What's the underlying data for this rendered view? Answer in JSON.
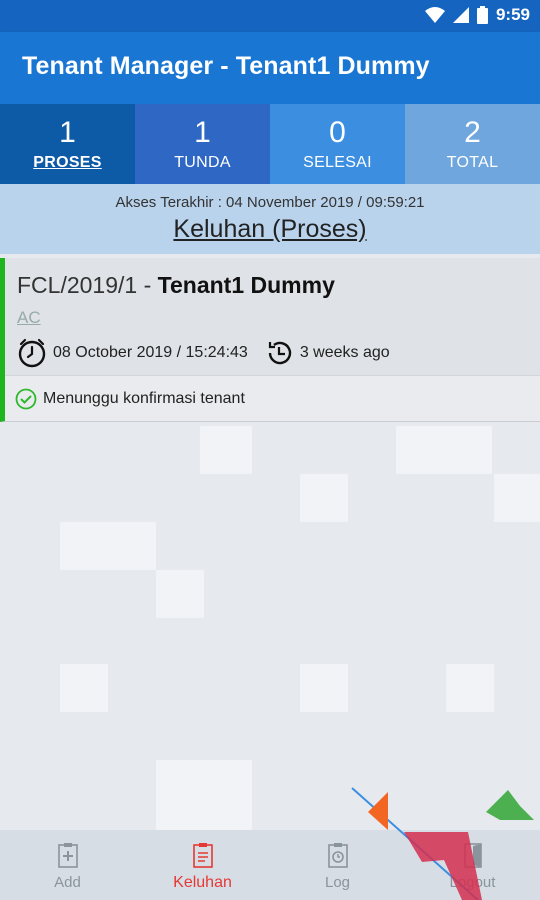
{
  "status_bar": {
    "time": "9:59"
  },
  "app_bar": {
    "title": "Tenant Manager - Tenant1 Dummy"
  },
  "stats": [
    {
      "count": "1",
      "label": "PROSES"
    },
    {
      "count": "1",
      "label": "TUNDA"
    },
    {
      "count": "0",
      "label": "SELESAI"
    },
    {
      "count": "2",
      "label": "TOTAL"
    }
  ],
  "info": {
    "last_access": "Akses Terakhir : 04 November 2019 / 09:59:21",
    "heading": "Keluhan (Proses)"
  },
  "complaint": {
    "code": "FCL/2019/1",
    "separator": " - ",
    "tenant": "Tenant1 Dummy",
    "category": "AC",
    "datetime": "08 October 2019 / 15:24:43",
    "relative": "3 weeks ago",
    "status": "Menunggu konfirmasi tenant",
    "accent_color": "#1eb51e"
  },
  "bottom_nav": [
    {
      "label": "Add",
      "icon": "add-note-icon"
    },
    {
      "label": "Keluhan",
      "icon": "clipboard-icon"
    },
    {
      "label": "Log",
      "icon": "log-clock-icon"
    },
    {
      "label": "Logout",
      "icon": "logout-door-icon"
    }
  ],
  "colors": {
    "primary": "#1976d2",
    "active_tab": "#e53935"
  }
}
